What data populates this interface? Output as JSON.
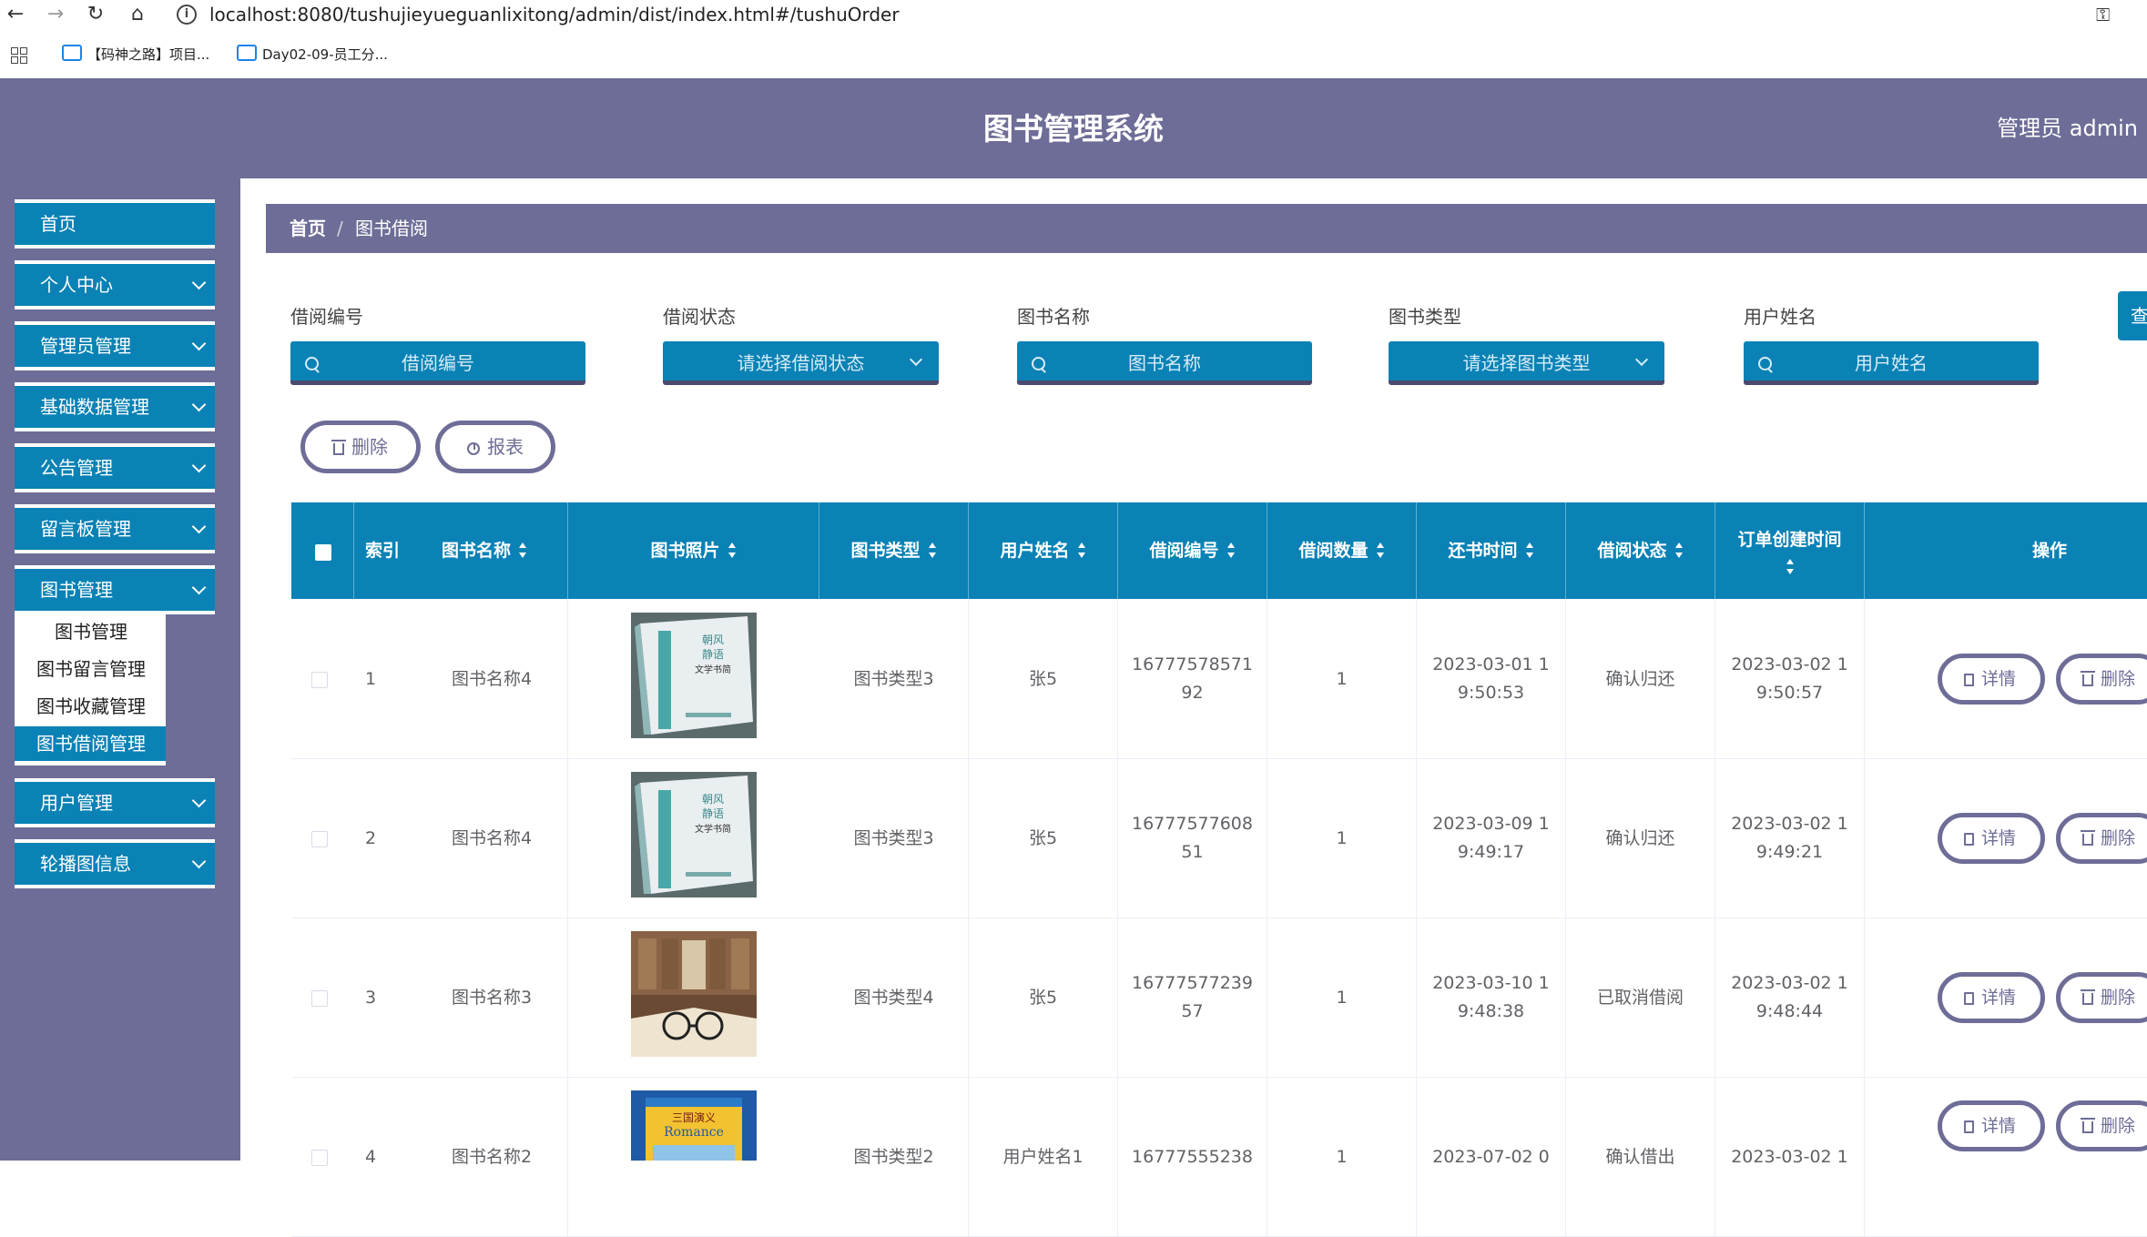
{
  "browser": {
    "url": "localhost:8080/tushujieyueguanlixitong/admin/dist/index.html#/tushuOrder",
    "bookmarks": [
      "【码神之路】项目...",
      "Day02-09-员工分..."
    ]
  },
  "header": {
    "title": "图书管理系统",
    "admin": "管理员 admin"
  },
  "sidebar": {
    "items": [
      {
        "label": "首页",
        "expandable": false
      },
      {
        "label": "个人中心",
        "expandable": true
      },
      {
        "label": "管理员管理",
        "expandable": true
      },
      {
        "label": "基础数据管理",
        "expandable": true
      },
      {
        "label": "公告管理",
        "expandable": true
      },
      {
        "label": "留言板管理",
        "expandable": true
      },
      {
        "label": "图书管理",
        "expandable": true
      },
      {
        "label": "用户管理",
        "expandable": true
      },
      {
        "label": "轮播图信息",
        "expandable": true
      }
    ],
    "submenu": [
      "图书管理",
      "图书留言管理",
      "图书收藏管理",
      "图书借阅管理"
    ],
    "active_submenu": "图书借阅管理"
  },
  "breadcrumb": {
    "home": "首页",
    "separator": "/",
    "current": "图书借阅"
  },
  "filters": [
    {
      "label": "借阅编号",
      "placeholder": "借阅编号",
      "kind": "input"
    },
    {
      "label": "借阅状态",
      "placeholder": "请选择借阅状态",
      "kind": "select"
    },
    {
      "label": "图书名称",
      "placeholder": "图书名称",
      "kind": "input"
    },
    {
      "label": "图书类型",
      "placeholder": "请选择图书类型",
      "kind": "select"
    },
    {
      "label": "用户姓名",
      "placeholder": "用户姓名",
      "kind": "input"
    }
  ],
  "search_button": "查",
  "actions": {
    "delete": "删除",
    "report": "报表"
  },
  "table": {
    "columns": [
      "索引",
      "图书名称",
      "图书照片",
      "图书类型",
      "用户姓名",
      "借阅编号",
      "借阅数量",
      "还书时间",
      "借阅状态",
      "订单创建时间",
      "操作"
    ],
    "row_buttons": {
      "detail": "详情",
      "delete": "删除"
    },
    "rows": [
      {
        "index": "1",
        "book_name": "图书名称4",
        "photo": "book-cover-green-icon",
        "book_type": "图书类型3",
        "user_name": "张5",
        "order_no": [
          "16777578571",
          "92"
        ],
        "qty": "1",
        "return_time": [
          "2023-03-01 1",
          "9:50:53"
        ],
        "status": "确认归还",
        "created": [
          "2023-03-02 1",
          "9:50:57"
        ]
      },
      {
        "index": "2",
        "book_name": "图书名称4",
        "photo": "book-cover-green-icon",
        "book_type": "图书类型3",
        "user_name": "张5",
        "order_no": [
          "16777577608",
          "51"
        ],
        "qty": "1",
        "return_time": [
          "2023-03-09 1",
          "9:49:17"
        ],
        "status": "确认归还",
        "created": [
          "2023-03-02 1",
          "9:49:21"
        ]
      },
      {
        "index": "3",
        "book_name": "图书名称3",
        "photo": "library-glasses-icon",
        "book_type": "图书类型4",
        "user_name": "张5",
        "order_no": [
          "16777577239",
          "57"
        ],
        "qty": "1",
        "return_time": [
          "2023-03-10 1",
          "9:48:38"
        ],
        "status": "已取消借阅",
        "created": [
          "2023-03-02 1",
          "9:48:44"
        ]
      },
      {
        "index": "4",
        "book_name": "图书名称2",
        "photo": "book-cover-romance-icon",
        "book_type": "图书类型2",
        "user_name": "用户姓名1",
        "order_no": [
          "16777555238",
          ""
        ],
        "qty": "1",
        "return_time": [
          "2023-07-02 0",
          ""
        ],
        "status": "确认借出",
        "created": [
          "2023-03-02 1",
          ""
        ]
      }
    ]
  },
  "colors": {
    "primary": "#0a82b5",
    "header": "#6d6d97",
    "accent": "#6d6d97"
  }
}
